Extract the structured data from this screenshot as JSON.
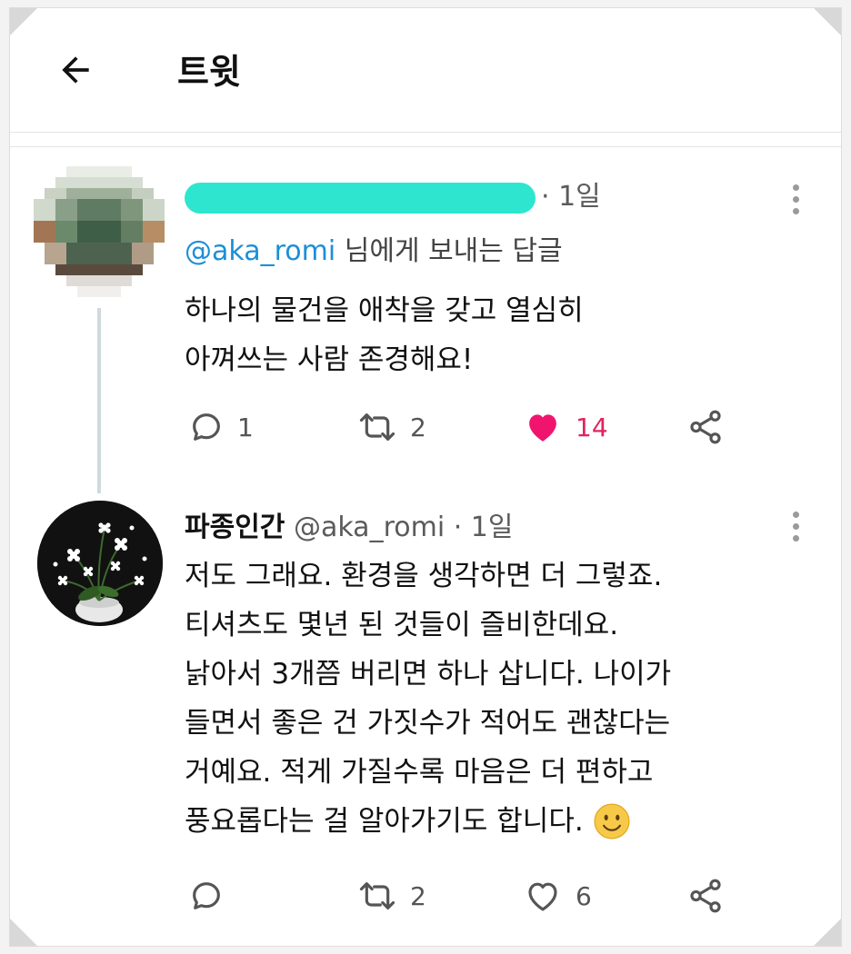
{
  "header": {
    "title": "트윗",
    "back_icon": "arrow-left-icon"
  },
  "tweet1": {
    "time": "· 1일",
    "reply_to_handle": "@aka_romi",
    "reply_to_suffix": " 님에게 보내는 답글",
    "body_lines": [
      "하나의 물건을 애착을 갖고 열심히",
      "아껴쓰는 사람 존경해요!"
    ],
    "actions": {
      "reply_count": "1",
      "retweet_count": "2",
      "like_count": "14",
      "liked": true
    }
  },
  "tweet2": {
    "display_name": "파종인간",
    "handle": "@aka_romi",
    "time": "· 1일",
    "body_lines": [
      "저도 그래요. 환경을 생각하면 더 그렇죠.",
      "티셔츠도 몇년 된 것들이 즐비한데요.",
      "낡아서 3개쯤 버리면 하나 삽니다. 나이가",
      "들면서 좋은 건 가짓수가 적어도 괜찮다는",
      "거예요. 적게 가질수록 마음은 더 편하고",
      "풍요롭다는 걸 알아가기도 합니다."
    ],
    "actions": {
      "reply_count": "",
      "retweet_count": "2",
      "like_count": "6",
      "liked": false
    }
  },
  "colors": {
    "accent": "#1b8fd6",
    "like": "#e0245e",
    "redaction": "#2ee6cf",
    "thread_line": "#cfd9de"
  }
}
